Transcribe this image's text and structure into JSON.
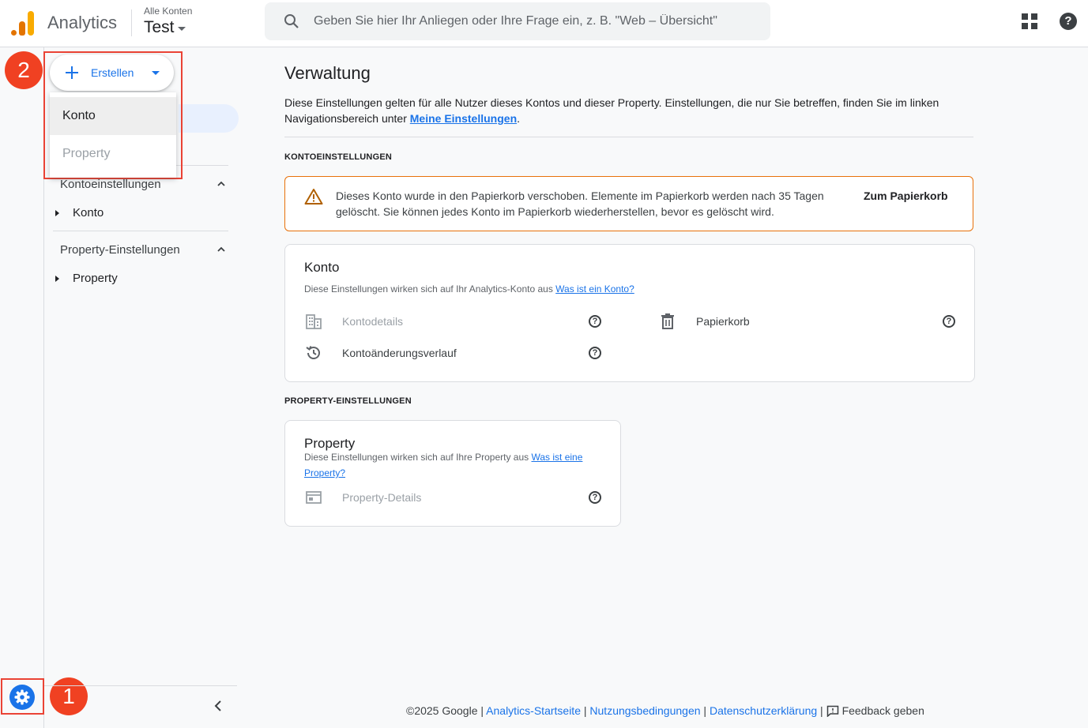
{
  "header": {
    "app_name": "Analytics",
    "account_label": "Alle Konten",
    "account_name": "Test",
    "search_placeholder": "Geben Sie hier Ihr Anliegen oder Ihre Frage ein, z. B. \"Web – Übersicht\""
  },
  "create_menu": {
    "button_label": "Erstellen",
    "items": [
      {
        "label": "Konto",
        "state": "hover"
      },
      {
        "label": "Property",
        "state": "disabled"
      }
    ]
  },
  "sidebar": {
    "sections": [
      {
        "label": "Kontoeinstellungen",
        "item": "Konto"
      },
      {
        "label": "Property-Einstellungen",
        "item": "Property"
      }
    ]
  },
  "annotations": {
    "step1": "1",
    "step2": "2",
    "color": "#f04122"
  },
  "main": {
    "title": "Verwaltung",
    "intro_text": "Diese Einstellungen gelten für alle Nutzer dieses Kontos und dieser Property. Einstellungen, die nur Sie betreffen, finden Sie im linken Navigationsbereich unter ",
    "intro_link": "Meine Einstellungen",
    "intro_end": ".",
    "account_section_label": "KONTOEINSTELLUNGEN",
    "warning": {
      "text": "Dieses Konto wurde in den Papierkorb verschoben. Elemente im Papierkorb werden nach 35 Tagen gelöscht. Sie können jedes Konto im Papierkorb wiederherstellen, bevor es gelöscht wird.",
      "action": "Zum Papierkorb"
    },
    "account_card": {
      "title": "Konto",
      "desc": "Diese Einstellungen wirken sich auf Ihr Analytics-Konto aus ",
      "link": "Was ist ein Konto?",
      "rows": [
        "Kontodetails",
        "Kontoänderungsverlauf",
        "Papierkorb"
      ]
    },
    "property_section_label": "PROPERTY-EINSTELLUNGEN",
    "property_card": {
      "title": "Property",
      "desc": "Diese Einstellungen wirken sich auf Ihre Property aus ",
      "link": "Was ist eine Property?",
      "rows": [
        "Property-Details"
      ]
    }
  },
  "footer": {
    "copyright": "©2025 Google",
    "links": [
      "Analytics-Startseite",
      "Nutzungsbedingungen",
      "Datenschutzerklärung"
    ],
    "feedback": "Feedback geben"
  }
}
